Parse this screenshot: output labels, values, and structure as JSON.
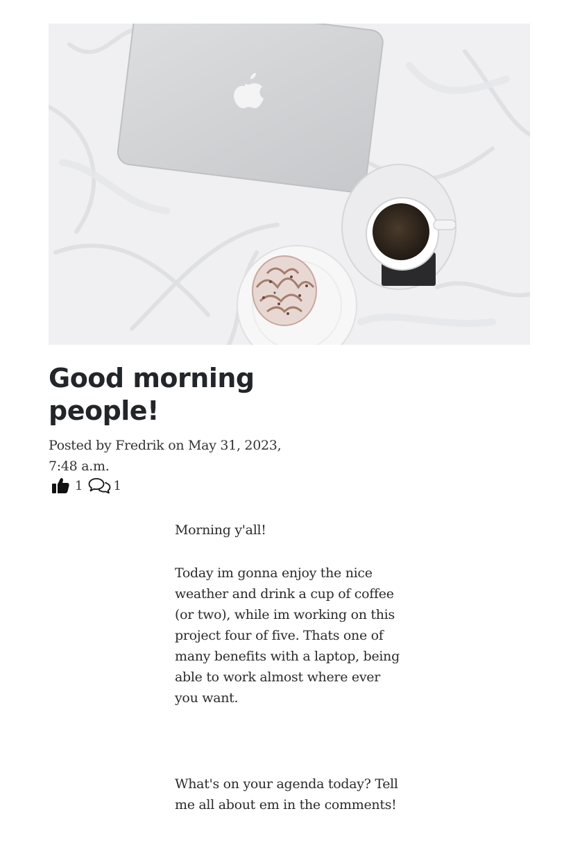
{
  "post": {
    "image_alt": "Laptop, cupcake and cup of coffee on white bed sheets",
    "title": "Good morning people!",
    "meta": "Posted by Fredrik on May 31, 2023, 7:48 a.m.",
    "likes_count": "1",
    "comments_count": "1",
    "icons": {
      "like": "thumbs-up-icon",
      "comment": "comments-icon"
    },
    "content": {
      "paragraph_1": "Morning y'all!",
      "paragraph_2": "Today im gonna enjoy the nice weather and drink a cup of coffee (or two), while im working on this project four of five. Thats one of many benefits with a laptop, being able to work almost where ever you want.",
      "paragraph_3": "What's on your agenda today? Tell me all about em in the comments!"
    }
  }
}
